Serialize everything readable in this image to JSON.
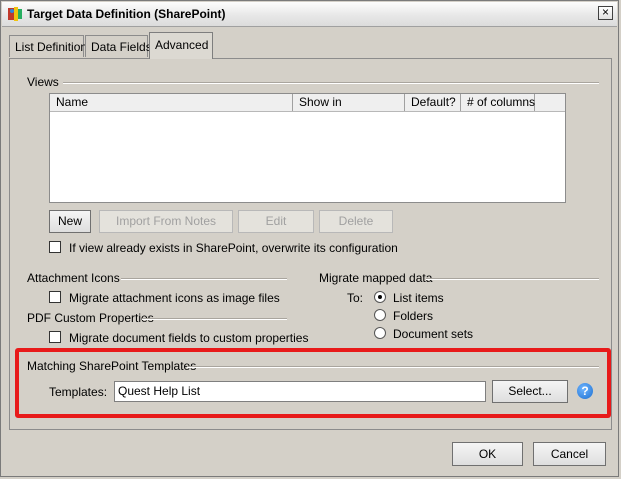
{
  "window": {
    "title": "Target Data Definition (SharePoint)",
    "close_symbol": "×"
  },
  "tabs": [
    {
      "label": "List Definition",
      "active": false
    },
    {
      "label": "Data Fields",
      "active": false
    },
    {
      "label": "Advanced",
      "active": true
    }
  ],
  "views": {
    "group_label": "Views",
    "columns": [
      "Name",
      "Show in",
      "Default?",
      "# of columns"
    ],
    "rows": [],
    "buttons": {
      "new": "New",
      "import_from_notes": "Import From Notes",
      "edit": "Edit",
      "delete": "Delete"
    },
    "overwrite_checkbox": {
      "label": "If view already exists in SharePoint, overwrite its configuration",
      "checked": false
    }
  },
  "attachment_icons": {
    "group_label": "Attachment Icons",
    "checkbox": {
      "label": "Migrate attachment icons as image files",
      "checked": false
    }
  },
  "pdf_custom_properties": {
    "group_label": "PDF Custom Properties",
    "checkbox": {
      "label": "Migrate document fields to custom properties",
      "checked": false
    }
  },
  "migrate_mapped_data": {
    "group_label": "Migrate mapped data",
    "to_label": "To:",
    "options": [
      {
        "label": "List items",
        "selected": true
      },
      {
        "label": "Folders",
        "selected": false
      },
      {
        "label": "Document sets",
        "selected": false
      }
    ]
  },
  "templates": {
    "group_label": "Matching SharePoint Templates",
    "field_label": "Templates:",
    "value": "Quest Help List",
    "select_button": "Select...",
    "help_symbol": "?"
  },
  "footer": {
    "ok": "OK",
    "cancel": "Cancel"
  },
  "colors": {
    "highlight": "#e81a1a",
    "dialog_bg": "#d4d0c8",
    "help_blue": "#1d6fd0"
  }
}
